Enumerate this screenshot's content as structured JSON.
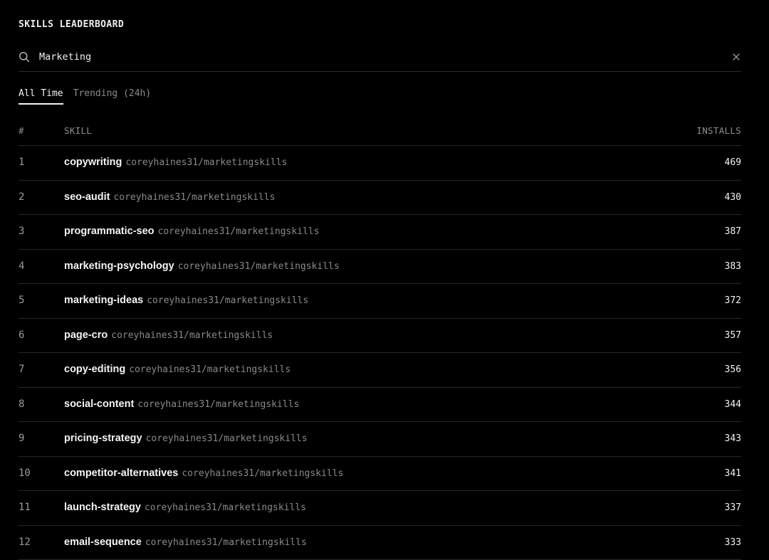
{
  "header": {
    "title": "SKILLS LEADERBOARD"
  },
  "search": {
    "value": "Marketing",
    "icon": "search-icon",
    "clear_icon": "close-icon"
  },
  "tabs": [
    {
      "label": "All Time",
      "active": true
    },
    {
      "label": "Trending (24h)",
      "active": false
    }
  ],
  "table": {
    "columns": {
      "rank": "#",
      "skill": "SKILL",
      "installs": "INSTALLS"
    },
    "rows": [
      {
        "rank": "1",
        "name": "copywriting",
        "repo": "coreyhaines31/marketingskills",
        "installs": "469"
      },
      {
        "rank": "2",
        "name": "seo-audit",
        "repo": "coreyhaines31/marketingskills",
        "installs": "430"
      },
      {
        "rank": "3",
        "name": "programmatic-seo",
        "repo": "coreyhaines31/marketingskills",
        "installs": "387"
      },
      {
        "rank": "4",
        "name": "marketing-psychology",
        "repo": "coreyhaines31/marketingskills",
        "installs": "383"
      },
      {
        "rank": "5",
        "name": "marketing-ideas",
        "repo": "coreyhaines31/marketingskills",
        "installs": "372"
      },
      {
        "rank": "6",
        "name": "page-cro",
        "repo": "coreyhaines31/marketingskills",
        "installs": "357"
      },
      {
        "rank": "7",
        "name": "copy-editing",
        "repo": "coreyhaines31/marketingskills",
        "installs": "356"
      },
      {
        "rank": "8",
        "name": "social-content",
        "repo": "coreyhaines31/marketingskills",
        "installs": "344"
      },
      {
        "rank": "9",
        "name": "pricing-strategy",
        "repo": "coreyhaines31/marketingskills",
        "installs": "343"
      },
      {
        "rank": "10",
        "name": "competitor-alternatives",
        "repo": "coreyhaines31/marketingskills",
        "installs": "341"
      },
      {
        "rank": "11",
        "name": "launch-strategy",
        "repo": "coreyhaines31/marketingskills",
        "installs": "337"
      },
      {
        "rank": "12",
        "name": "email-sequence",
        "repo": "coreyhaines31/marketingskills",
        "installs": "333"
      }
    ]
  },
  "colors": {
    "background": "#000000",
    "text": "#ededed",
    "muted": "#8a8a8a",
    "divider": "#262626"
  }
}
